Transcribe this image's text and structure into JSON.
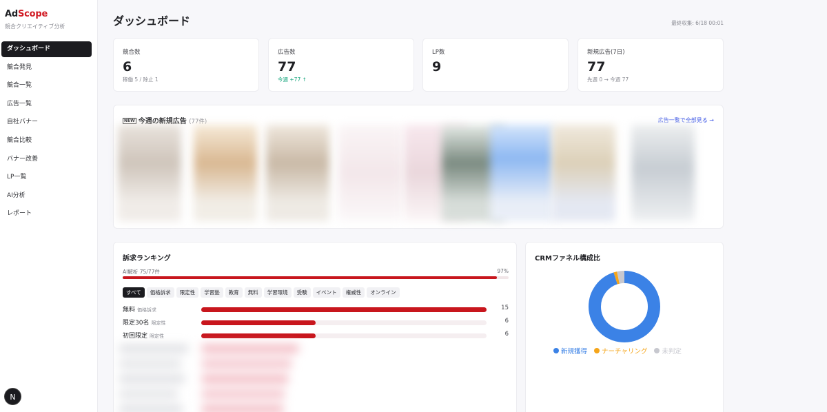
{
  "sidebar": {
    "brand_prefix": "Ad",
    "brand_suffix": "Scope",
    "brand_sub": "競合クリエイティブ分析",
    "items": [
      "ダッシュボード",
      "競合発見",
      "競合一覧",
      "広告一覧",
      "自社バナー",
      "競合比較",
      "バナー改善",
      "LP一覧",
      "AI分析",
      "レポート"
    ],
    "badge": "N"
  },
  "header": {
    "title": "ダッシュボード",
    "last_update": "最終収集: 6/18 00:01"
  },
  "stats": [
    {
      "label": "競合数",
      "value": "6",
      "sub": "稼働 5 / 除止 1"
    },
    {
      "label": "広告数",
      "value": "77",
      "sub": "今週 +77 ↑"
    },
    {
      "label": "LP数",
      "value": "9",
      "sub": ""
    },
    {
      "label": "新規広告(7日)",
      "value": "77",
      "sub": "先週 0 → 今週 77"
    }
  ],
  "new_ads": {
    "icon_text": "NEW",
    "title": "今週の新規広告",
    "count": "(77件)",
    "see_all": "広告一覧で全部見る →"
  },
  "ranking": {
    "title": "訴求ランキング",
    "ai_label": "AI解析 75/77件",
    "ai_pct_text": "97%",
    "ai_pct": 97,
    "chips": [
      "すべて",
      "価格訴求",
      "限定性",
      "学習塾",
      "教育",
      "無料",
      "学習環境",
      "受験",
      "イベント",
      "権威性",
      "オンライン"
    ],
    "rows": [
      {
        "name": "無料",
        "tag": "価格訴求",
        "value": 15
      },
      {
        "name": "限定30名",
        "tag": "限定性",
        "value": 6
      },
      {
        "name": "初回限定",
        "tag": "限定性",
        "value": 6
      }
    ],
    "max": 15
  },
  "crm": {
    "title": "CRMファネル構成比",
    "legend": [
      {
        "label": "新規獲得",
        "color": "#3b82e6"
      },
      {
        "label": "ナーチャリング",
        "color": "#f5a51a"
      },
      {
        "label": "未判定",
        "color": "#c7c8cf"
      }
    ],
    "shares": [
      0.95,
      0.015,
      0.035
    ]
  },
  "colors": {
    "accent": "#c8161d",
    "dark": "#1b1b1f",
    "link": "#3b55e6",
    "up": "#10a37a"
  }
}
